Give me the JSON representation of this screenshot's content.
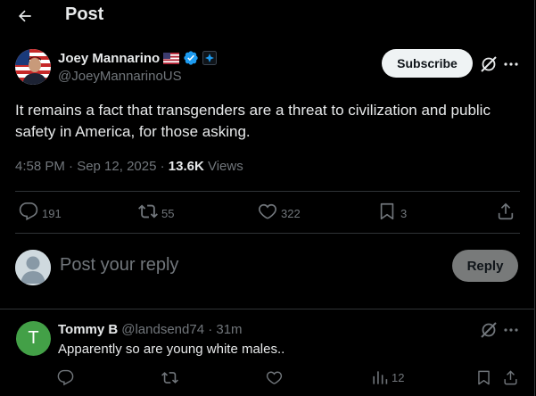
{
  "header": {
    "title": "Post"
  },
  "post": {
    "author_name": "Joey Mannarino",
    "handle": "@JoeyMannarinoUS",
    "subscribe_label": "Subscribe",
    "text": "It remains a fact that transgenders are a threat to civilization and public safety in America, for those asking.",
    "time": "4:58 PM · Sep 12, 2025 · ",
    "views_count": "13.6K",
    "views_label": " Views",
    "stats": {
      "replies": "191",
      "reposts": "55",
      "likes": "322",
      "bookmarks": "3"
    }
  },
  "composer": {
    "placeholder": "Post your reply",
    "button_label": "Reply"
  },
  "reply": {
    "avatar_letter": "T",
    "author_name": "Tommy B",
    "handle_time": "@landsend74 · 31m",
    "text": "Apparently so are young white males..",
    "views": "12"
  },
  "colors": {
    "background": "#000000",
    "text": "#e7e9ea",
    "muted": "#71767b",
    "verified": "#1d9bf0",
    "divider": "#2f3336",
    "reply_avatar": "#43a047"
  }
}
